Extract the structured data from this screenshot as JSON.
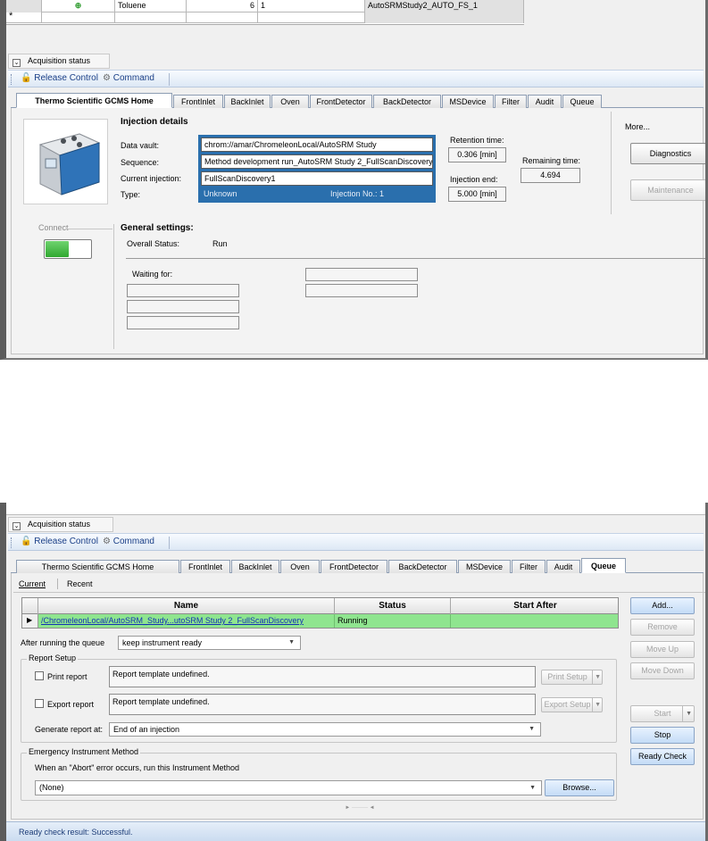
{
  "panel1": {
    "table": {
      "row1": {
        "name": "Toluene",
        "amount": "6",
        "num": "1",
        "file": "AutoSRMStudy2_AUTO_FS_1"
      },
      "new_row_marker": "*"
    },
    "acq_label": "Acquisition status",
    "toolbar": {
      "release_control": "Release Control",
      "command": "Command"
    },
    "tabs": [
      "Thermo Scientific GCMS Home",
      "FrontInlet",
      "BackInlet",
      "Oven",
      "FrontDetector",
      "BackDetector",
      "MSDevice",
      "Filter",
      "Audit",
      "Queue"
    ],
    "injection": {
      "heading": "Injection details",
      "data_vault_label": "Data vault:",
      "data_vault": "chrom://amar/ChromeleonLocal/AutoSRM Study",
      "sequence_label": "Sequence:",
      "sequence": "Method development run_AutoSRM Study 2_FullScanDiscovery",
      "current_label": "Current injection:",
      "current": "FullScanDiscovery1",
      "type_label": "Type:",
      "type": "Unknown",
      "inj_no": "Injection No.: 1",
      "retention_label": "Retention time:",
      "retention": "0.306 [min]",
      "remaining_label": "Remaining time:",
      "remaining": "4.694",
      "end_label": "Injection end:",
      "end": "5.000 [min]"
    },
    "more": {
      "label": "More...",
      "diagnostics": "Diagnostics",
      "maintenance": "Maintenance"
    },
    "connect_label": "Connect",
    "general": {
      "heading": "General settings:",
      "overall_label": "Overall Status:",
      "overall": "Run",
      "waiting_label": "Waiting for:"
    }
  },
  "panel2": {
    "acq_label": "Acquisition status",
    "toolbar": {
      "release_control": "Release Control",
      "command": "Command"
    },
    "tabs": [
      "Thermo Scientific GCMS Home",
      "FrontInlet",
      "BackInlet",
      "Oven",
      "FrontDetector",
      "BackDetector",
      "MSDevice",
      "Filter",
      "Audit",
      "Queue"
    ],
    "subtabs": [
      "Current",
      "Recent"
    ],
    "queue": {
      "headers": [
        "Name",
        "Status",
        "Start After"
      ],
      "row": {
        "name": "/ChromeleonLocal/AutoSRM_Study...utoSRM Study 2_FullScanDiscovery",
        "status": "Running",
        "start_after": ""
      }
    },
    "side_buttons": {
      "add": "Add...",
      "remove": "Remove",
      "move_up": "Move Up",
      "move_down": "Move Down",
      "start": "Start",
      "stop": "Stop",
      "ready_check": "Ready Check"
    },
    "after_label": "After running the queue",
    "after_value": "keep instrument ready",
    "report": {
      "title": "Report Setup",
      "print_label": "Print report",
      "print_value": "Report template undefined.",
      "print_setup": "Print Setup",
      "export_label": "Export report",
      "export_value": "Report template undefined.",
      "export_setup": "Export Setup",
      "generate_label": "Generate report at:",
      "generate_value": "End of an injection"
    },
    "emergency": {
      "title": "Emergency Instrument Method",
      "desc": "When an \"Abort\" error occurs, run this Instrument Method",
      "value": "(None)",
      "browse": "Browse..."
    },
    "status": "Ready check result: Successful."
  }
}
